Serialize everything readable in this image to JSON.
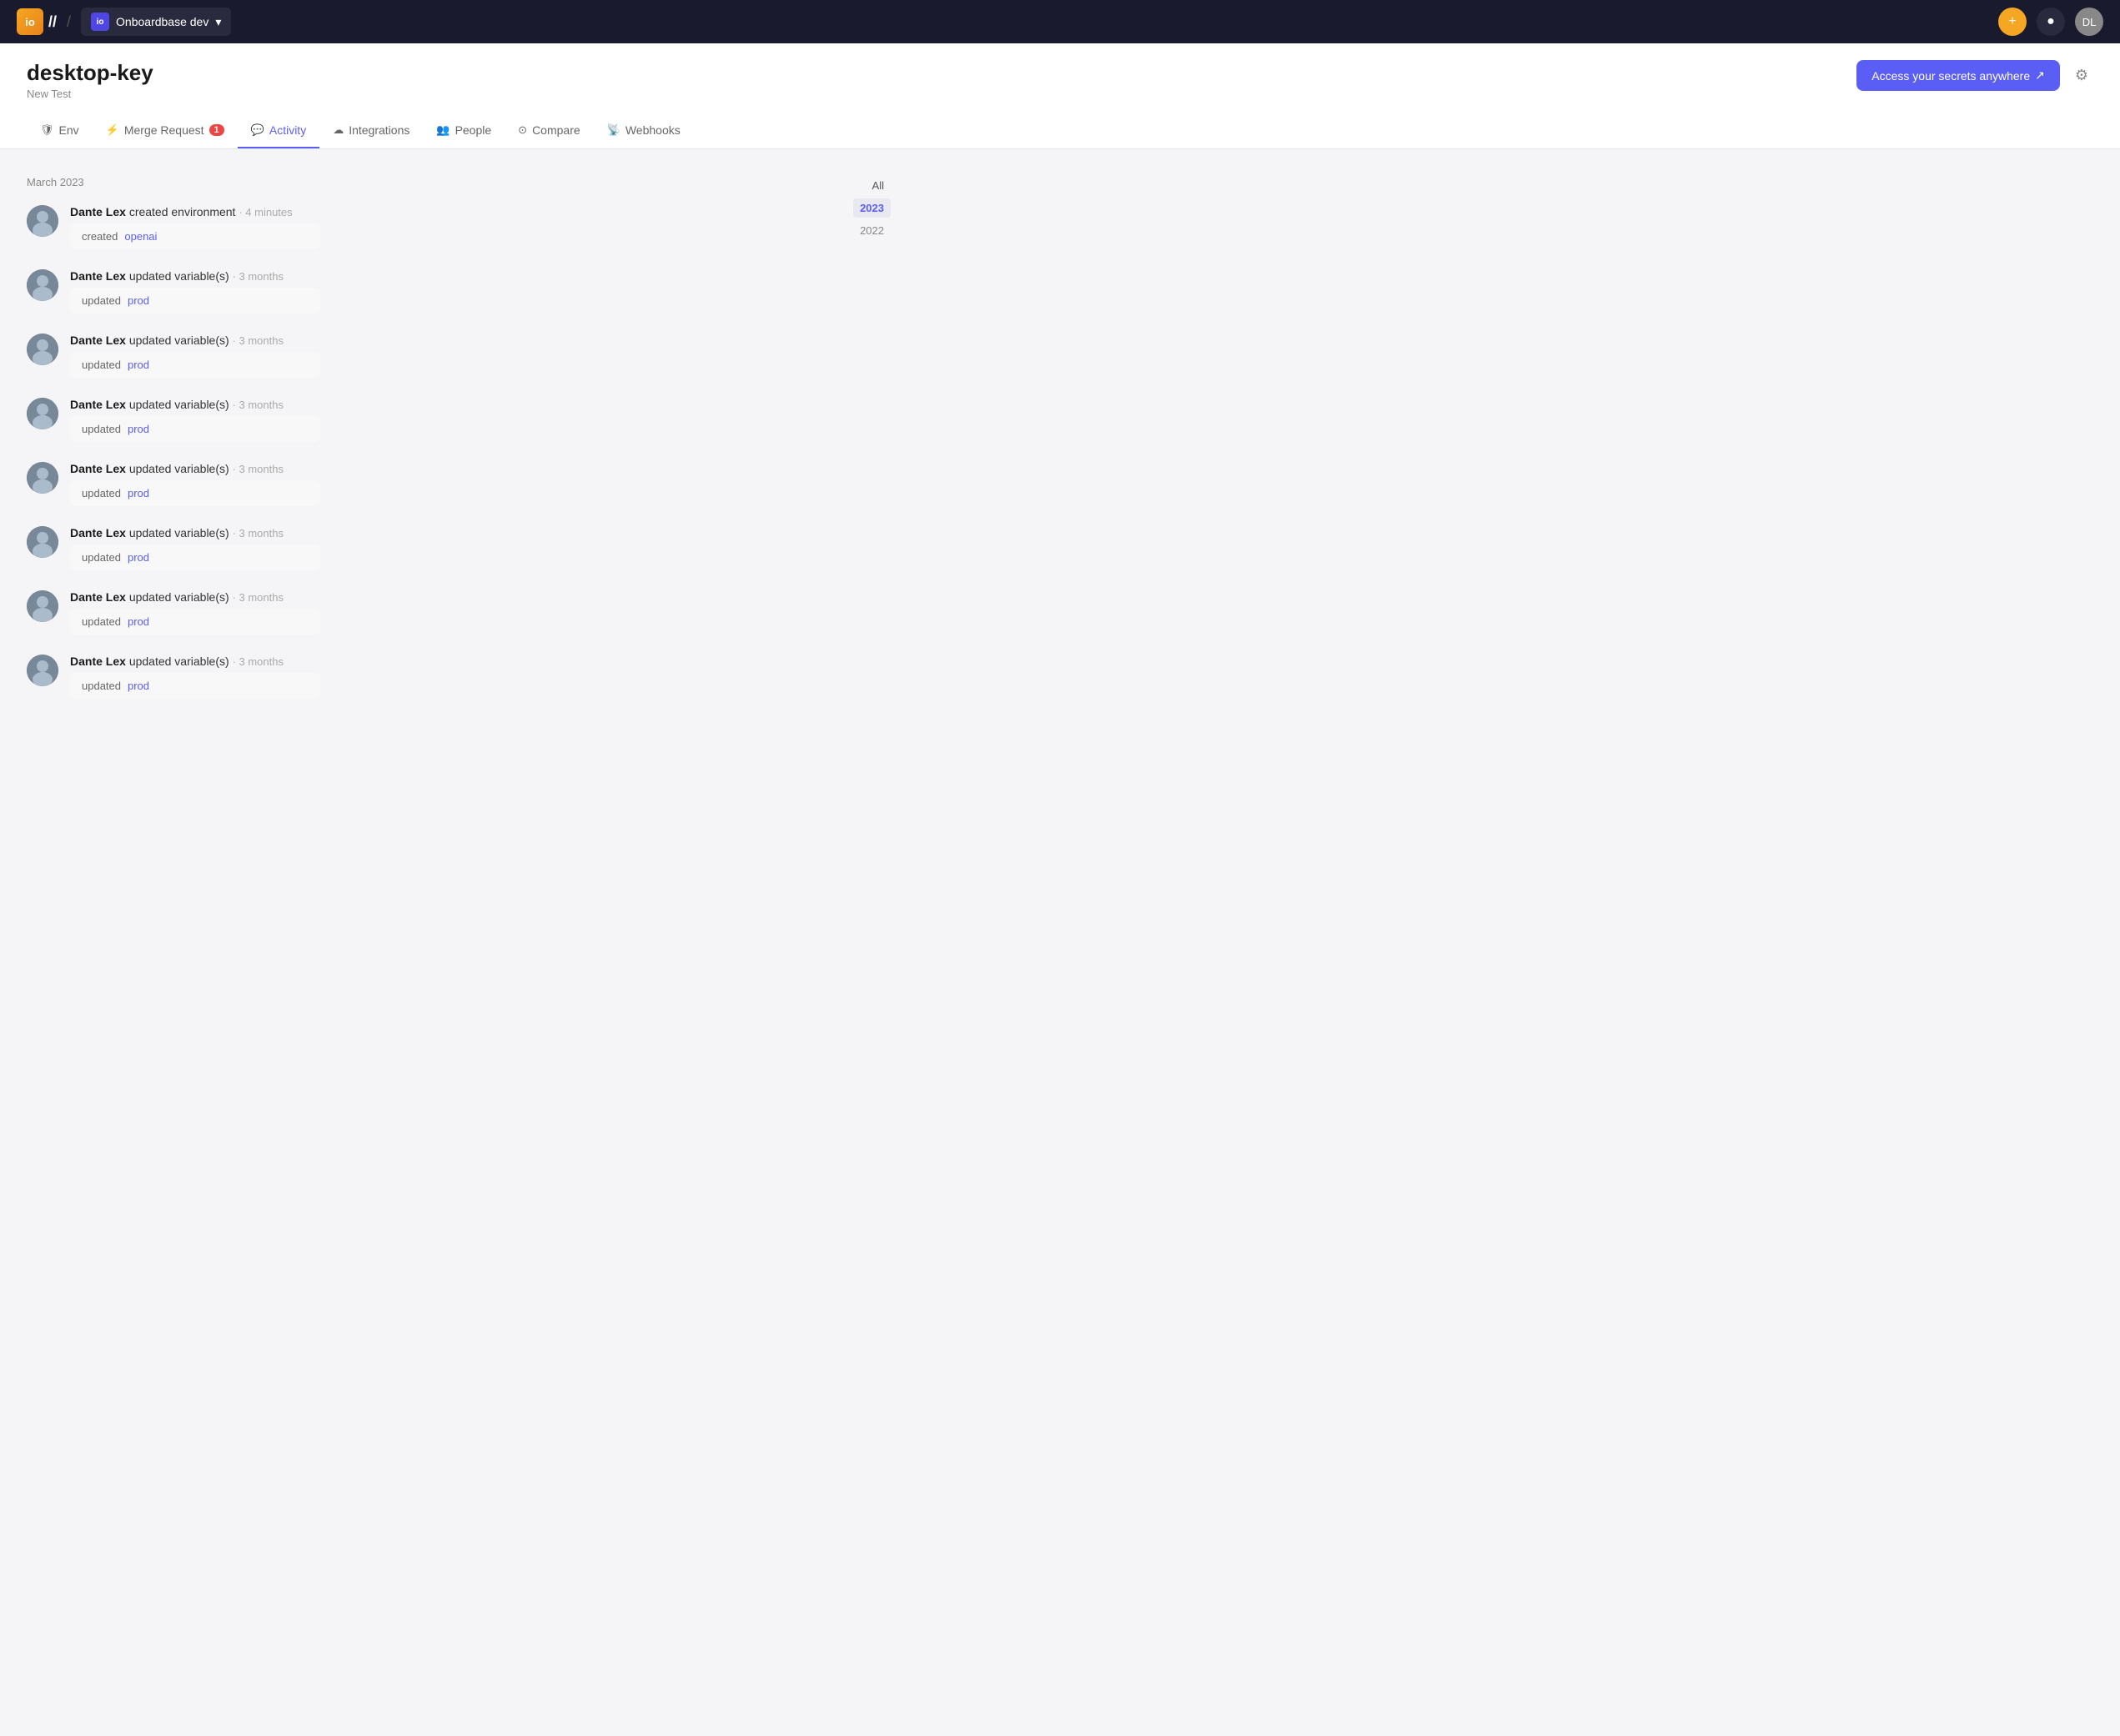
{
  "topnav": {
    "logo_text": "//",
    "logo_icon_text": "io",
    "separator": "/",
    "workspace_label": "Onboardbase dev",
    "workspace_icon_text": "io",
    "add_icon": "+",
    "help_icon": "●",
    "avatar_text": "DL"
  },
  "page": {
    "title": "desktop-key",
    "subtitle": "New Test",
    "access_button": "Access your secrets anywhere",
    "settings_icon": "⚙"
  },
  "tabs": [
    {
      "id": "env",
      "label": "Env",
      "icon": "🛡",
      "active": false,
      "badge": null
    },
    {
      "id": "merge-request",
      "label": "Merge Request",
      "icon": "⚡",
      "active": false,
      "badge": "1"
    },
    {
      "id": "activity",
      "label": "Activity",
      "icon": "💬",
      "active": true,
      "badge": null
    },
    {
      "id": "integrations",
      "label": "Integrations",
      "icon": "☁",
      "active": false,
      "badge": null
    },
    {
      "id": "people",
      "label": "People",
      "icon": "👥",
      "active": false,
      "badge": null
    },
    {
      "id": "compare",
      "label": "Compare",
      "icon": "{×}",
      "active": false,
      "badge": null
    },
    {
      "id": "webhooks",
      "label": "Webhooks",
      "icon": "📡",
      "active": false,
      "badge": null
    }
  ],
  "activity": {
    "month_label": "March 2023",
    "items": [
      {
        "user": "Dante Lex",
        "action": "created environment",
        "time": "4 minutes",
        "detail_prefix": "created",
        "detail_tag": "openai"
      },
      {
        "user": "Dante Lex",
        "action": "updated variable(s)",
        "time": "3 months",
        "detail_prefix": "updated",
        "detail_tag": "prod"
      },
      {
        "user": "Dante Lex",
        "action": "updated variable(s)",
        "time": "3 months",
        "detail_prefix": "updated",
        "detail_tag": "prod"
      },
      {
        "user": "Dante Lex",
        "action": "updated variable(s)",
        "time": "3 months",
        "detail_prefix": "updated",
        "detail_tag": "prod"
      },
      {
        "user": "Dante Lex",
        "action": "updated variable(s)",
        "time": "3 months",
        "detail_prefix": "updated",
        "detail_tag": "prod"
      },
      {
        "user": "Dante Lex",
        "action": "updated variable(s)",
        "time": "3 months",
        "detail_prefix": "updated",
        "detail_tag": "prod"
      },
      {
        "user": "Dante Lex",
        "action": "updated variable(s)",
        "time": "3 months",
        "detail_prefix": "updated",
        "detail_tag": "prod"
      },
      {
        "user": "Dante Lex",
        "action": "updated variable(s)",
        "time": "3 months",
        "detail_prefix": "updated",
        "detail_tag": "prod"
      }
    ]
  },
  "year_filter": {
    "options": [
      {
        "label": "All",
        "active": false
      },
      {
        "label": "2023",
        "active": true
      },
      {
        "label": "2022",
        "active": false
      }
    ]
  }
}
